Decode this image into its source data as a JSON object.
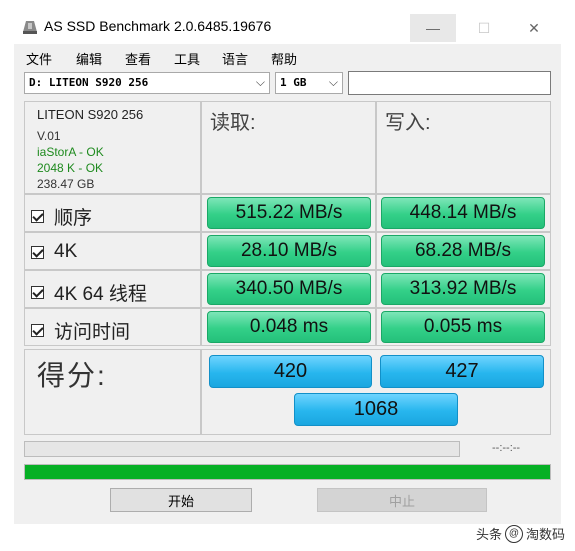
{
  "window": {
    "title": "AS SSD Benchmark 2.0.6485.19676",
    "controls": {
      "minimize": "—",
      "maximize": "☐",
      "close": "✕"
    }
  },
  "menu": [
    "文件",
    "编辑",
    "查看",
    "工具",
    "语言",
    "帮助"
  ],
  "toolbar": {
    "drive_select": "D: LITEON S920 256",
    "size_select": "1 GB",
    "extra_field": ""
  },
  "drive_info": {
    "model": "LITEON S920 256",
    "firmware": "V.01",
    "driver": "iaStorA - OK",
    "alignment": "2048 K - OK",
    "capacity": "238.47 GB"
  },
  "headers": {
    "read": "读取:",
    "write": "写入:"
  },
  "tests": [
    {
      "label": "顺序",
      "checked": true,
      "read": "515.22 MB/s",
      "write": "448.14 MB/s"
    },
    {
      "label": "4K",
      "checked": true,
      "read": "28.10 MB/s",
      "write": "68.28 MB/s"
    },
    {
      "label": "4K 64 线程",
      "checked": true,
      "read": "340.50 MB/s",
      "write": "313.92 MB/s"
    },
    {
      "label": "访问时间",
      "checked": true,
      "read": "0.048 ms",
      "write": "0.055 ms"
    }
  ],
  "score": {
    "label": "得分:",
    "read": "420",
    "write": "427",
    "total": "1068"
  },
  "progress": {
    "current_fraction": 0,
    "overall_fraction": 1.0,
    "time": "--:--:--"
  },
  "buttons": {
    "start": "开始",
    "stop": "中止"
  },
  "watermark": {
    "prefix": "头条",
    "icon": "@",
    "name": "淘数码"
  },
  "colors": {
    "result_green": "#33d088",
    "score_blue": "#27b6ee",
    "progress_green": "#06b025",
    "ok_text": "#1e8a1e"
  }
}
